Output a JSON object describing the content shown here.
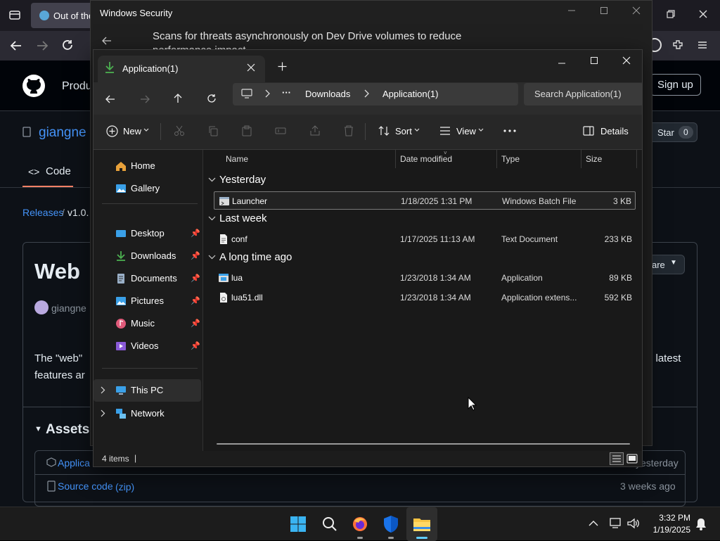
{
  "browser": {
    "tab_title": "Out of the",
    "github": {
      "nav_label": "Produ",
      "signup_label": "Sign up",
      "repo_owner": "giangne",
      "star_label": "Star",
      "star_count": "0",
      "tab_code": "Code",
      "breadcrumb_releases": "Releases",
      "breadcrumb_sep": "/",
      "breadcrumb_version": "v1.0.",
      "release_title": "Web",
      "author": "giangne",
      "compare_label": "are",
      "desc_left": "The \"web\"",
      "desc_left2": "features ar",
      "desc_right": "e latest",
      "assets_label": "Assets",
      "asset1": "Applica",
      "asset1_time": "yesterday",
      "asset2_name": "Source code",
      "asset2_ext": "(zip)",
      "asset2_time": "3 weeks ago"
    }
  },
  "winsec": {
    "title": "Windows Security",
    "body": "Scans for threats asynchronously on Dev Drive volumes to reduce performance impact"
  },
  "explorer": {
    "tab_title": "Application(1)",
    "breadcrumb": [
      "Downloads",
      "Application(1)"
    ],
    "search_placeholder": "Search Application(1)",
    "cmd": {
      "new": "New",
      "sort": "Sort",
      "view": "View",
      "details": "Details"
    },
    "nav": [
      {
        "label": "Home",
        "icon": "home-icon"
      },
      {
        "label": "Gallery",
        "icon": "gallery-icon"
      },
      {
        "label": "Desktop",
        "icon": "desktop-icon",
        "pinned": true
      },
      {
        "label": "Downloads",
        "icon": "downloads-icon",
        "pinned": true
      },
      {
        "label": "Documents",
        "icon": "documents-icon",
        "pinned": true
      },
      {
        "label": "Pictures",
        "icon": "pictures-icon",
        "pinned": true
      },
      {
        "label": "Music",
        "icon": "music-icon",
        "pinned": true
      },
      {
        "label": "Videos",
        "icon": "videos-icon",
        "pinned": true
      },
      {
        "label": "This PC",
        "icon": "this-pc-icon",
        "selected": true
      },
      {
        "label": "Network",
        "icon": "network-icon"
      }
    ],
    "columns": {
      "name": "Name",
      "date": "Date modified",
      "type": "Type",
      "size": "Size"
    },
    "groups": [
      {
        "label": "Yesterday",
        "files": [
          {
            "name": "Launcher",
            "date": "1/18/2025 1:31 PM",
            "type": "Windows Batch File",
            "size": "3 KB",
            "selected": true
          }
        ]
      },
      {
        "label": "Last week",
        "files": [
          {
            "name": "conf",
            "date": "1/17/2025 11:13 AM",
            "type": "Text Document",
            "size": "233 KB"
          }
        ]
      },
      {
        "label": "A long time ago",
        "files": [
          {
            "name": "lua",
            "date": "1/23/2018 1:34 AM",
            "type": "Application",
            "size": "89 KB"
          },
          {
            "name": "lua51.dll",
            "date": "1/23/2018 1:34 AM",
            "type": "Application extens...",
            "size": "592 KB"
          }
        ]
      }
    ],
    "status": "4 items",
    "status_sep": "|"
  },
  "taskbar": {
    "time": "3:32 PM",
    "date": "1/19/2025"
  },
  "colors": {
    "accent": "#60cdff",
    "download_green": "#4caf50",
    "github_link": "#4493f8"
  }
}
